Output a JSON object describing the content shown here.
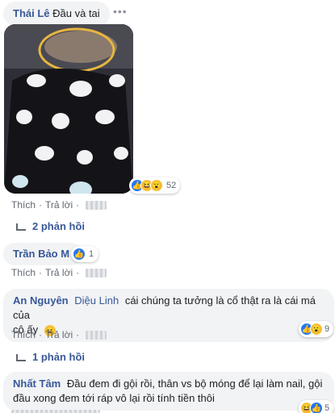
{
  "comments": [
    {
      "author": "Thái Lê",
      "text": "Đầu và tai",
      "more": "•••",
      "reactions": {
        "count": "52"
      },
      "actions": {
        "like": "Thích",
        "reply": "Trả lời"
      },
      "replies": "2 phản hồi"
    },
    {
      "author": "Trần Bảo M",
      "reactions": {
        "count": "1"
      },
      "actions": {
        "like": "Thích",
        "reply": "Trả lời"
      }
    },
    {
      "author": "An Nguyên",
      "mention": "Diệu Linh",
      "text_line1": "cái chúng ta tưởng là cổ thật ra là cái má của",
      "text_line2": "cô ấy",
      "reactions": {
        "count": "9"
      },
      "actions": {
        "like": "Thích",
        "reply": "Trả lời"
      },
      "replies": "1 phản hồi"
    },
    {
      "author": "Nhất Tâm",
      "text_line1": "Đầu đem đi gội rồi, thân vs bộ móng để lại làm nail, gội",
      "text_line2": "đầu xong đem tới ráp vô lại rồi tính tiền thôi",
      "reactions": {
        "count": "5"
      }
    }
  ],
  "icons": {
    "like": "like-icon",
    "haha": "haha-icon",
    "wow": "wow-icon",
    "reply_arrow": "reply-arrow-icon"
  }
}
